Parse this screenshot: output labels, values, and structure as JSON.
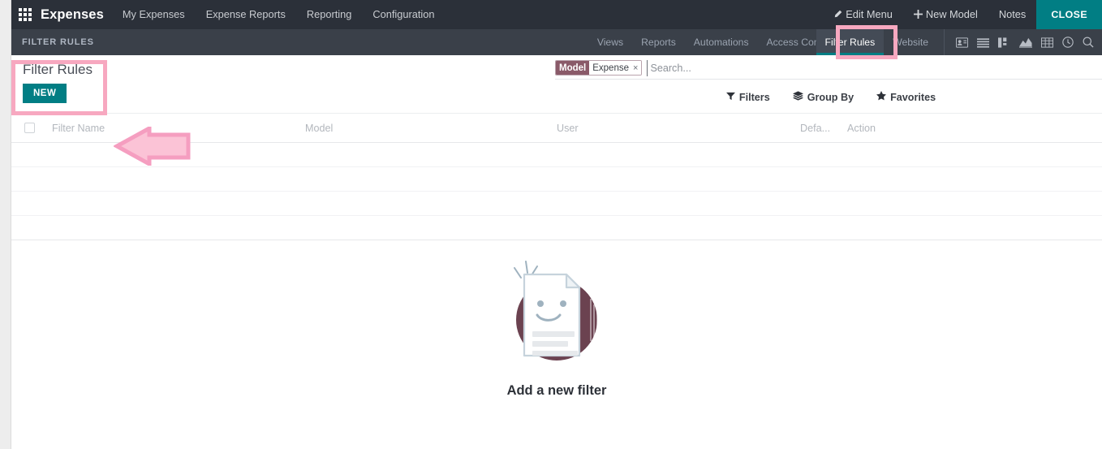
{
  "navbar": {
    "apps_icon": "apps-grid-icon",
    "brand": "Expenses",
    "items": [
      {
        "label": "My Expenses"
      },
      {
        "label": "Expense Reports"
      },
      {
        "label": "Reporting"
      },
      {
        "label": "Configuration"
      }
    ],
    "right_items": [
      {
        "label": "Edit Menu",
        "icon": "pencil-icon"
      },
      {
        "label": "New Model",
        "icon": "plus-icon"
      },
      {
        "label": "Notes",
        "icon": ""
      }
    ],
    "close_label": "CLOSE",
    "background": "#2b3039",
    "accent": "#017e84"
  },
  "subbar": {
    "breadcrumb": "FILTER RULES",
    "tabs": [
      {
        "label": "Views",
        "active": false
      },
      {
        "label": "Reports",
        "active": false
      },
      {
        "label": "Automations",
        "active": false
      },
      {
        "label": "Access Control",
        "active": false
      },
      {
        "label": "Filter Rules",
        "active": true
      },
      {
        "label": "Website",
        "active": false
      }
    ],
    "icons": [
      "contact-card-icon",
      "list-icon",
      "kanban-icon",
      "area-chart-icon",
      "pivot-table-icon",
      "clock-icon",
      "search-icon"
    ],
    "background": "#3a4049",
    "active_underline": "#017e84"
  },
  "highlight": {
    "color": "#f7a8c0",
    "arrow_name": "left-pointing-arrow-annotation",
    "tab_box_name": "filter-rules-tab-highlight",
    "title_box_name": "filter-rules-title-highlight"
  },
  "control_panel": {
    "title": "Filter Rules",
    "new_label": "NEW"
  },
  "search": {
    "facet_label": "Model",
    "facet_value": "Expense",
    "facet_remove": "×",
    "placeholder": "Search...",
    "value": "",
    "tools": [
      {
        "label": "Filters",
        "icon": "funnel-icon"
      },
      {
        "label": "Group By",
        "icon": "layers-icon"
      },
      {
        "label": "Favorites",
        "icon": "star-icon"
      }
    ]
  },
  "table": {
    "columns": [
      {
        "label": "Filter Name"
      },
      {
        "label": "Model"
      },
      {
        "label": "User"
      },
      {
        "label": "Defa..."
      },
      {
        "label": "Action"
      }
    ],
    "rows": [],
    "empty_row_count": 4
  },
  "empty_state": {
    "text": "Add a new filter",
    "illustration": "smiling-document-icon",
    "circle_color": "#6b4250"
  }
}
